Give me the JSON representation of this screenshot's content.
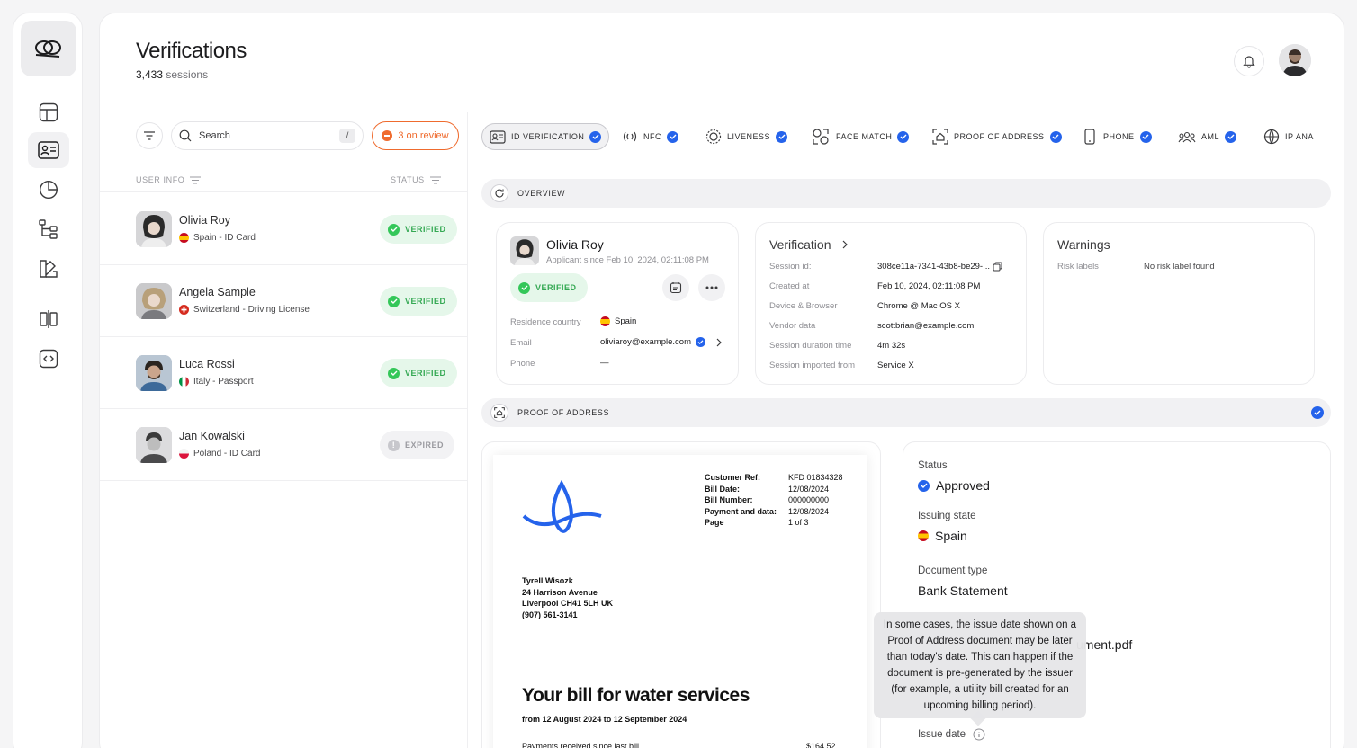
{
  "header": {
    "title": "Verifications",
    "session_count": "3,433",
    "session_suffix": "sessions"
  },
  "list": {
    "search_placeholder": "Search",
    "search_shortcut": "/",
    "review_label": "3 on review",
    "col_user_info": "USER INFO",
    "col_status": "STATUS",
    "rows": [
      {
        "name": "Olivia Roy",
        "meta": "Spain - ID Card",
        "status": "VERIFIED"
      },
      {
        "name": "Angela Sample",
        "meta": "Switzerland - Driving License",
        "status": "VERIFIED"
      },
      {
        "name": "Luca Rossi",
        "meta": "Italy - Passport",
        "status": "VERIFIED"
      },
      {
        "name": "Jan Kowalski",
        "meta": "Poland - ID Card",
        "status": "EXPIRED"
      }
    ]
  },
  "tabs": [
    "ID VERIFICATION",
    "NFC",
    "LIVENESS",
    "FACE MATCH",
    "PROOF OF ADDRESS",
    "PHONE",
    "AML",
    "IP ANA"
  ],
  "overview": {
    "label": "OVERVIEW",
    "profile": {
      "name": "Olivia Roy",
      "since": "Applicant since Feb 10, 2024, 02:11:08 PM",
      "status": "VERIFIED",
      "fields": [
        {
          "k": "Residence country",
          "v": "Spain"
        },
        {
          "k": "Email",
          "v": "oliviaroy@example.com"
        },
        {
          "k": "Phone",
          "v": "—"
        }
      ]
    },
    "verification": {
      "title": "Verification",
      "fields": [
        {
          "k": "Session id:",
          "v": "308ce11a-7341-43b8-be29-..."
        },
        {
          "k": "Created at",
          "v": "Feb 10, 2024, 02:11:08 PM"
        },
        {
          "k": "Device & Browser",
          "v": "Chrome @ Mac OS X"
        },
        {
          "k": "Vendor data",
          "v": "scottbrian@example.com"
        },
        {
          "k": "Session duration time",
          "v": "4m 32s"
        },
        {
          "k": "Session imported from",
          "v": "Service X"
        }
      ]
    },
    "warnings": {
      "title": "Warnings",
      "k": "Risk labels",
      "v": "No risk label found"
    }
  },
  "poa": {
    "label": "PROOF OF ADDRESS",
    "doc": {
      "ref_labels": [
        "Customer Ref:",
        "Bill Date:",
        "Bill Number:",
        "Payment and data:",
        "Page"
      ],
      "ref_values": [
        "KFD 01834328",
        "12/08/2024",
        "000000000",
        "12/08/2024",
        "1 of 3"
      ],
      "address": [
        "Tyrell Wisozk",
        "24 Harrison Avenue",
        "Liverpool CH41 5LH UK",
        "(907) 561-3141"
      ],
      "heading": "Your bill for water services",
      "period": "from 12 August 2024 to 12 September 2024",
      "line_label": "Payments received since last bill",
      "line_value": "$164.52"
    },
    "info": {
      "status_label": "Status",
      "status_value": "Approved",
      "issuing_label": "Issuing state",
      "issuing_value": "Spain",
      "doctype_label": "Document type",
      "doctype_value": "Bank Statement",
      "file_value": "ument.pdf",
      "issue_label": "Issue date"
    },
    "tooltip": "In some cases, the issue date shown on a Proof of Address document may be later than today's date. This can happen if the document is pre-generated by the issuer (for example, a utility bill created for an upcoming billing period)."
  },
  "colors": {
    "accent": "#2563eb",
    "verified": "#34c759",
    "review": "#ef6b2e"
  }
}
